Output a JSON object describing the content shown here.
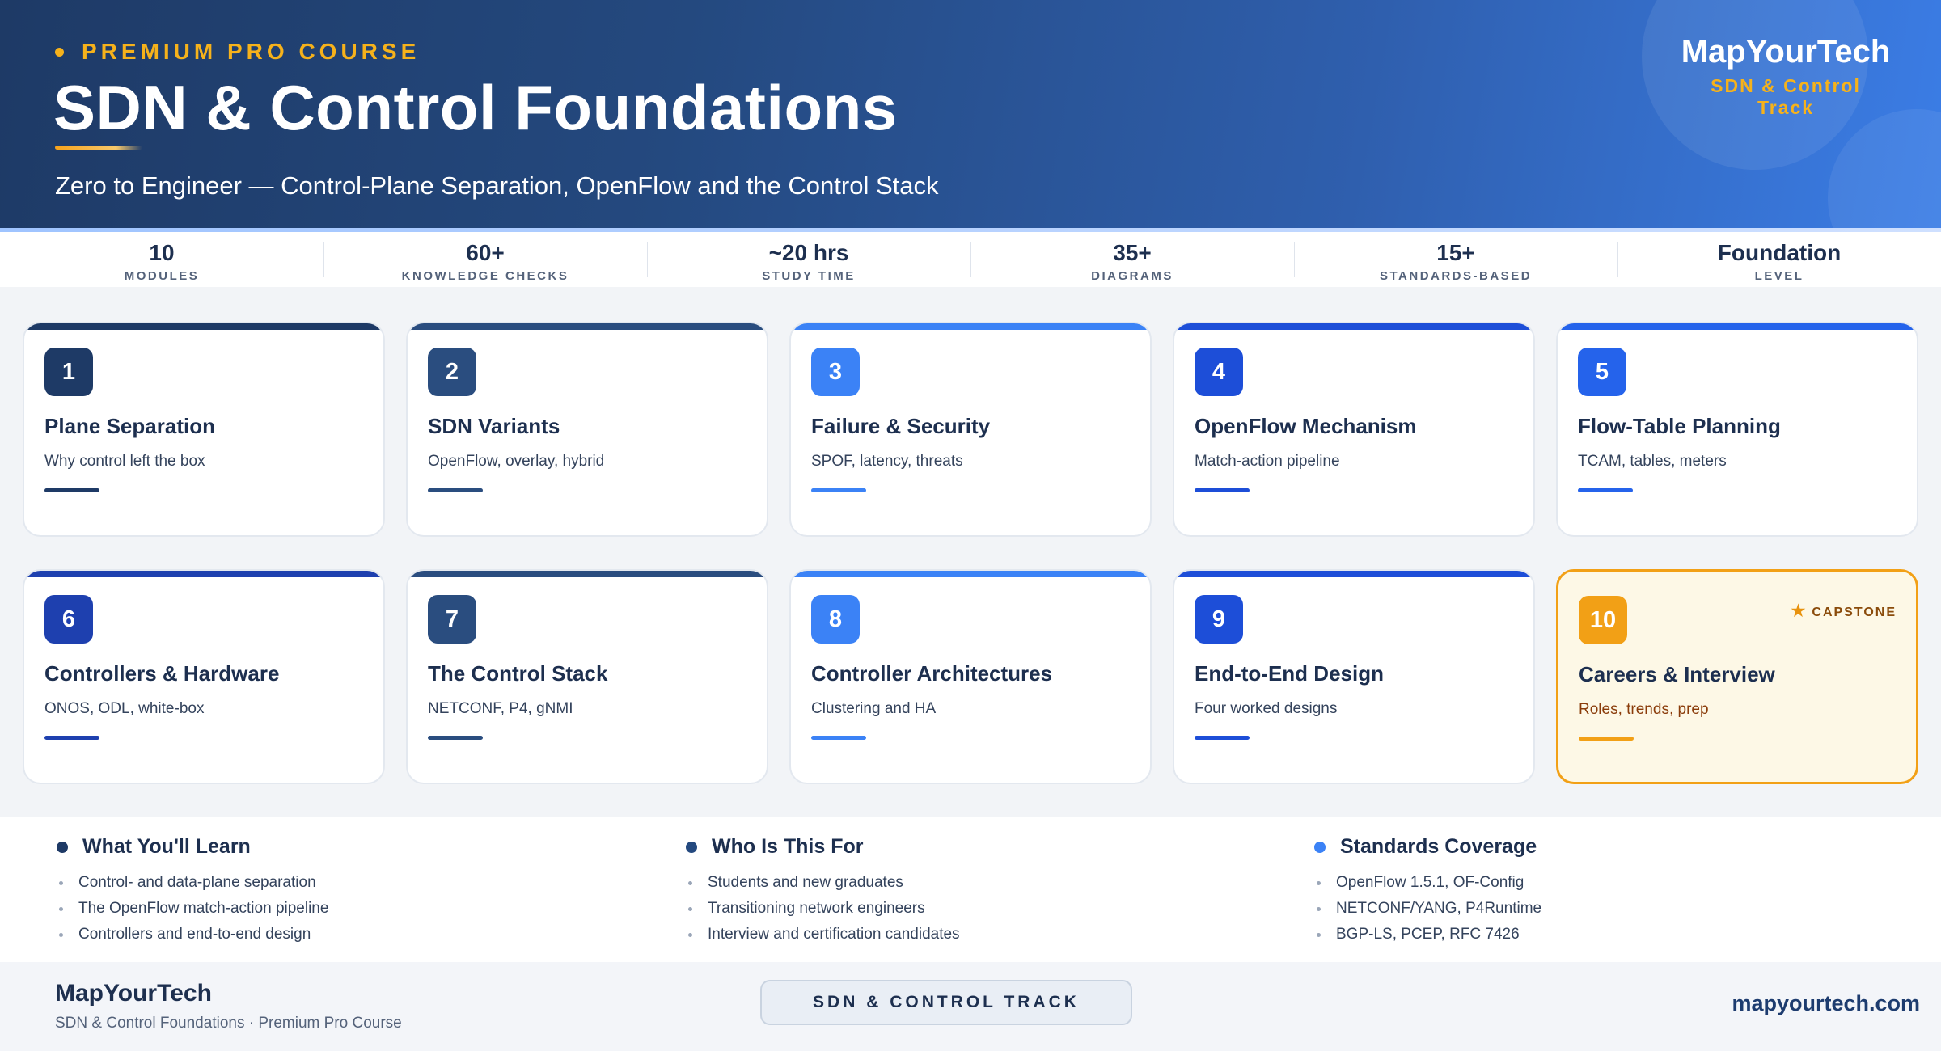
{
  "header": {
    "eyebrow": "PREMIUM PRO COURSE",
    "title": "SDN & Control Foundations",
    "subtitle": "Zero to Engineer — Control-Plane Separation, OpenFlow and the Control Stack",
    "brand_name": "MapYourTech",
    "brand_track": "SDN & Control Track"
  },
  "stats": [
    {
      "value": "10",
      "label": "MODULES"
    },
    {
      "value": "60+",
      "label": "KNOWLEDGE CHECKS"
    },
    {
      "value": "~20 hrs",
      "label": "STUDY TIME"
    },
    {
      "value": "35+",
      "label": "DIAGRAMS"
    },
    {
      "value": "15+",
      "label": "STANDARDS-BASED"
    },
    {
      "value": "Foundation",
      "label": "LEVEL"
    }
  ],
  "modules": [
    {
      "number": "1",
      "title": "Plane Separation",
      "desc": "Why control left the box",
      "color": "#1e3a66"
    },
    {
      "number": "2",
      "title": "SDN Variants",
      "desc": "OpenFlow, overlay, hybrid",
      "color": "#2a4d7f"
    },
    {
      "number": "3",
      "title": "Failure & Security",
      "desc": "SPOF, latency, threats",
      "color": "#3b82f6"
    },
    {
      "number": "4",
      "title": "OpenFlow Mechanism",
      "desc": "Match-action pipeline",
      "color": "#1d4ed8"
    },
    {
      "number": "5",
      "title": "Flow-Table Planning",
      "desc": "TCAM, tables, meters",
      "color": "#2563eb"
    },
    {
      "number": "6",
      "title": "Controllers & Hardware",
      "desc": "ONOS, ODL, white-box",
      "color": "#1e40af"
    },
    {
      "number": "7",
      "title": "The Control Stack",
      "desc": "NETCONF, P4, gNMI",
      "color": "#2a4d7f"
    },
    {
      "number": "8",
      "title": "Controller Architectures",
      "desc": "Clustering and HA",
      "color": "#3b82f6"
    },
    {
      "number": "9",
      "title": "End-to-End Design",
      "desc": "Four worked designs",
      "color": "#1d4ed8"
    },
    {
      "number": "10",
      "title": "Careers & Interview",
      "desc": "Roles, trends, prep",
      "color": "#f2a016",
      "badge": "CAPSTONE"
    }
  ],
  "info": {
    "learn": {
      "title": "What You'll Learn",
      "color": "#1e3a66",
      "items": [
        "Control- and data-plane separation",
        "The OpenFlow match-action pipeline",
        "Controllers and end-to-end design"
      ]
    },
    "who": {
      "title": "Who Is This For",
      "color": "#24497f",
      "items": [
        "Students and new graduates",
        "Transitioning network engineers",
        "Interview and certification candidates"
      ]
    },
    "standards": {
      "title": "Standards Coverage",
      "color": "#3b82f6",
      "items": [
        "OpenFlow 1.5.1, OF-Config",
        "NETCONF/YANG, P4Runtime",
        "BGP-LS, PCEP, RFC 7426"
      ]
    }
  },
  "footer": {
    "brand": "MapYourTech",
    "sub": "SDN & Control Foundations · Premium Pro Course",
    "pill": "SDN & CONTROL TRACK",
    "url": "mapyourtech.com"
  }
}
